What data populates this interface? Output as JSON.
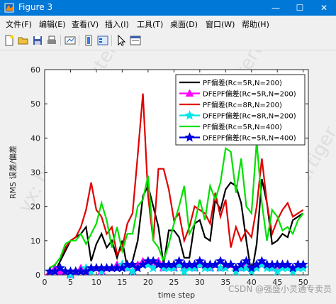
{
  "window": {
    "title": "Figure 3",
    "minimize": "—",
    "maximize": "☐",
    "close": "✕"
  },
  "menu": [
    {
      "label": "文件(F)"
    },
    {
      "label": "编辑(E)"
    },
    {
      "label": "查看(V)"
    },
    {
      "label": "插入(I)"
    },
    {
      "label": "工具(T)"
    },
    {
      "label": "桌面(D)"
    },
    {
      "label": "窗口(W)"
    },
    {
      "label": "帮助(H)"
    }
  ],
  "toolbar": {
    "icons": [
      "new-figure-icon",
      "open-file-icon",
      "save-icon",
      "print-icon",
      "link-plot-icon",
      "insert-colorbar-icon",
      "insert-legend-icon",
      "edit-plot-arrow-icon",
      "open-property-inspector-icon"
    ]
  },
  "colors": {
    "title_bar": "#0078d7",
    "watermark": "#c8c8c8"
  },
  "watermark": {
    "text": "vx: hustertiger",
    "csdn": "CSDN @强盛小灵通专卖员"
  },
  "chart_data": {
    "type": "line",
    "title": "",
    "xlabel": "time step",
    "ylabel": "RMS 误差/偏差",
    "xlim": [
      0,
      51
    ],
    "ylim": [
      0,
      60
    ],
    "xticks": [
      0,
      5,
      10,
      15,
      20,
      25,
      30,
      35,
      40,
      45,
      50
    ],
    "yticks": [
      0,
      10,
      20,
      30,
      40,
      50,
      60
    ],
    "grid": false,
    "legend_position": "top-right",
    "x": [
      1,
      2,
      3,
      4,
      5,
      6,
      7,
      8,
      9,
      10,
      11,
      12,
      13,
      14,
      15,
      16,
      17,
      18,
      19,
      20,
      21,
      22,
      23,
      24,
      25,
      26,
      27,
      28,
      29,
      30,
      31,
      32,
      33,
      34,
      35,
      36,
      37,
      38,
      39,
      40,
      41,
      42,
      43,
      44,
      45,
      46,
      47,
      48,
      49,
      50
    ],
    "series": [
      {
        "name": "PF偏差(Rc=5R,N=200)",
        "color": "#000000",
        "marker": "none",
        "values": [
          1,
          1,
          4,
          7,
          10,
          11,
          12,
          14,
          4,
          9,
          12,
          8,
          10,
          5,
          10,
          2,
          4,
          10,
          23,
          26,
          20,
          14,
          3,
          13,
          13,
          11,
          5,
          5,
          15,
          16,
          11,
          10,
          22,
          19,
          25,
          27,
          26,
          21,
          10,
          0,
          9,
          28,
          21,
          9,
          10,
          12,
          11,
          16,
          17,
          18
        ]
      },
      {
        "name": "DFEPF偏差(Rc=5R,N=200)",
        "color": "#ff00ff",
        "marker": "triangle",
        "values": [
          1,
          2,
          1,
          1,
          0,
          1,
          2,
          1,
          2,
          2,
          1,
          2,
          2,
          3,
          3,
          2,
          1,
          3,
          4,
          4,
          3,
          4,
          2,
          3,
          2,
          3,
          2,
          3,
          2,
          3,
          3,
          2,
          3,
          2,
          3,
          3,
          2,
          2,
          3,
          2,
          3,
          4,
          3,
          2,
          2,
          3,
          3,
          2,
          3,
          3
        ]
      },
      {
        "name": "PF偏差(Rc=8R,N=200)",
        "color": "#e00000",
        "marker": "none",
        "values": [
          2,
          3,
          5,
          8,
          10,
          11,
          14,
          19,
          27,
          19,
          17,
          12,
          14,
          6,
          8,
          15,
          18,
          35,
          53,
          23,
          10,
          31,
          31,
          25,
          16,
          18,
          10,
          14,
          20,
          19,
          18,
          15,
          24,
          17,
          22,
          8,
          14,
          10,
          13,
          11,
          20,
          34,
          21,
          12,
          16,
          19,
          21,
          17,
          18,
          19
        ]
      },
      {
        "name": "DFEPF偏差(Rc=8R,N=200)",
        "color": "#00e6e6",
        "marker": "star",
        "values": [
          1,
          1,
          2,
          1,
          0,
          1,
          1,
          2,
          1,
          2,
          1,
          2,
          2,
          2,
          3,
          2,
          1,
          2,
          3,
          3,
          2,
          3,
          2,
          2,
          2,
          3,
          1,
          2,
          2,
          3,
          2,
          2,
          3,
          2,
          2,
          3,
          1,
          2,
          2,
          1,
          2,
          3,
          2,
          2,
          1,
          2,
          2,
          1,
          2,
          2
        ]
      },
      {
        "name": "PF偏差(Rc=5R,N=400)",
        "color": "#00e000",
        "marker": "none",
        "values": [
          2,
          3,
          5,
          9,
          10,
          10,
          12,
          9,
          12,
          15,
          21,
          16,
          8,
          14,
          7,
          12,
          12,
          20,
          22,
          29,
          10,
          8,
          4,
          9,
          15,
          20,
          26,
          12,
          15,
          22,
          16,
          26,
          22,
          27,
          37,
          36,
          24,
          34,
          20,
          18,
          39,
          21,
          10,
          19,
          17,
          13,
          14,
          12,
          16,
          18
        ]
      },
      {
        "name": "DFEPF偏差(Rc=5R,N=400)",
        "color": "#0000e0",
        "marker": "star",
        "values": [
          1,
          1,
          2,
          1,
          1,
          1,
          1,
          1,
          2,
          2,
          2,
          2,
          2,
          2,
          2,
          3,
          3,
          2,
          3,
          4,
          4,
          3,
          3,
          3,
          3,
          4,
          3,
          3,
          3,
          4,
          3,
          3,
          3,
          4,
          3,
          3,
          2,
          3,
          4,
          2,
          3,
          4,
          3,
          3,
          3,
          3,
          3,
          2,
          3,
          3
        ]
      }
    ]
  }
}
